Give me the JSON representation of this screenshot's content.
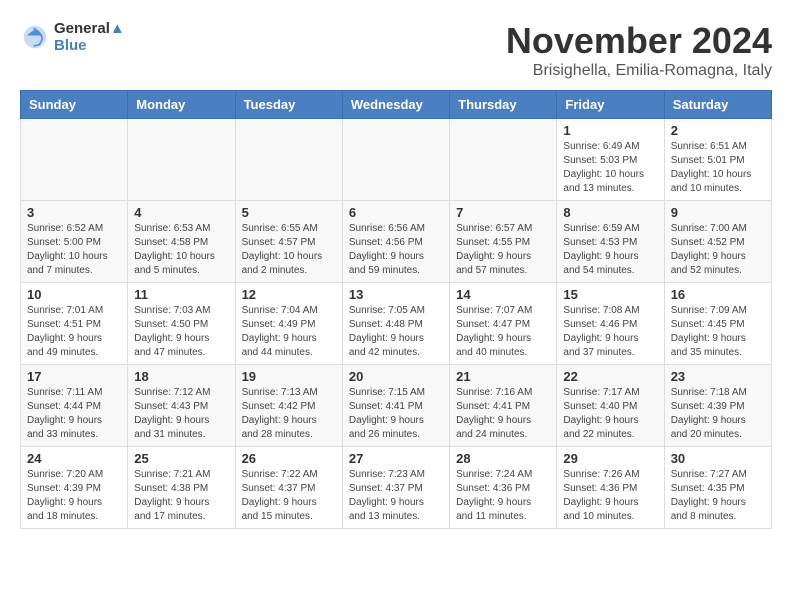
{
  "header": {
    "logo_line1": "General",
    "logo_line2": "Blue",
    "month": "November 2024",
    "location": "Brisighella, Emilia-Romagna, Italy"
  },
  "days_of_week": [
    "Sunday",
    "Monday",
    "Tuesday",
    "Wednesday",
    "Thursday",
    "Friday",
    "Saturday"
  ],
  "weeks": [
    [
      {
        "day": "",
        "info": ""
      },
      {
        "day": "",
        "info": ""
      },
      {
        "day": "",
        "info": ""
      },
      {
        "day": "",
        "info": ""
      },
      {
        "day": "",
        "info": ""
      },
      {
        "day": "1",
        "info": "Sunrise: 6:49 AM\nSunset: 5:03 PM\nDaylight: 10 hours\nand 13 minutes."
      },
      {
        "day": "2",
        "info": "Sunrise: 6:51 AM\nSunset: 5:01 PM\nDaylight: 10 hours\nand 10 minutes."
      }
    ],
    [
      {
        "day": "3",
        "info": "Sunrise: 6:52 AM\nSunset: 5:00 PM\nDaylight: 10 hours\nand 7 minutes."
      },
      {
        "day": "4",
        "info": "Sunrise: 6:53 AM\nSunset: 4:58 PM\nDaylight: 10 hours\nand 5 minutes."
      },
      {
        "day": "5",
        "info": "Sunrise: 6:55 AM\nSunset: 4:57 PM\nDaylight: 10 hours\nand 2 minutes."
      },
      {
        "day": "6",
        "info": "Sunrise: 6:56 AM\nSunset: 4:56 PM\nDaylight: 9 hours\nand 59 minutes."
      },
      {
        "day": "7",
        "info": "Sunrise: 6:57 AM\nSunset: 4:55 PM\nDaylight: 9 hours\nand 57 minutes."
      },
      {
        "day": "8",
        "info": "Sunrise: 6:59 AM\nSunset: 4:53 PM\nDaylight: 9 hours\nand 54 minutes."
      },
      {
        "day": "9",
        "info": "Sunrise: 7:00 AM\nSunset: 4:52 PM\nDaylight: 9 hours\nand 52 minutes."
      }
    ],
    [
      {
        "day": "10",
        "info": "Sunrise: 7:01 AM\nSunset: 4:51 PM\nDaylight: 9 hours\nand 49 minutes."
      },
      {
        "day": "11",
        "info": "Sunrise: 7:03 AM\nSunset: 4:50 PM\nDaylight: 9 hours\nand 47 minutes."
      },
      {
        "day": "12",
        "info": "Sunrise: 7:04 AM\nSunset: 4:49 PM\nDaylight: 9 hours\nand 44 minutes."
      },
      {
        "day": "13",
        "info": "Sunrise: 7:05 AM\nSunset: 4:48 PM\nDaylight: 9 hours\nand 42 minutes."
      },
      {
        "day": "14",
        "info": "Sunrise: 7:07 AM\nSunset: 4:47 PM\nDaylight: 9 hours\nand 40 minutes."
      },
      {
        "day": "15",
        "info": "Sunrise: 7:08 AM\nSunset: 4:46 PM\nDaylight: 9 hours\nand 37 minutes."
      },
      {
        "day": "16",
        "info": "Sunrise: 7:09 AM\nSunset: 4:45 PM\nDaylight: 9 hours\nand 35 minutes."
      }
    ],
    [
      {
        "day": "17",
        "info": "Sunrise: 7:11 AM\nSunset: 4:44 PM\nDaylight: 9 hours\nand 33 minutes."
      },
      {
        "day": "18",
        "info": "Sunrise: 7:12 AM\nSunset: 4:43 PM\nDaylight: 9 hours\nand 31 minutes."
      },
      {
        "day": "19",
        "info": "Sunrise: 7:13 AM\nSunset: 4:42 PM\nDaylight: 9 hours\nand 28 minutes."
      },
      {
        "day": "20",
        "info": "Sunrise: 7:15 AM\nSunset: 4:41 PM\nDaylight: 9 hours\nand 26 minutes."
      },
      {
        "day": "21",
        "info": "Sunrise: 7:16 AM\nSunset: 4:41 PM\nDaylight: 9 hours\nand 24 minutes."
      },
      {
        "day": "22",
        "info": "Sunrise: 7:17 AM\nSunset: 4:40 PM\nDaylight: 9 hours\nand 22 minutes."
      },
      {
        "day": "23",
        "info": "Sunrise: 7:18 AM\nSunset: 4:39 PM\nDaylight: 9 hours\nand 20 minutes."
      }
    ],
    [
      {
        "day": "24",
        "info": "Sunrise: 7:20 AM\nSunset: 4:39 PM\nDaylight: 9 hours\nand 18 minutes."
      },
      {
        "day": "25",
        "info": "Sunrise: 7:21 AM\nSunset: 4:38 PM\nDaylight: 9 hours\nand 17 minutes."
      },
      {
        "day": "26",
        "info": "Sunrise: 7:22 AM\nSunset: 4:37 PM\nDaylight: 9 hours\nand 15 minutes."
      },
      {
        "day": "27",
        "info": "Sunrise: 7:23 AM\nSunset: 4:37 PM\nDaylight: 9 hours\nand 13 minutes."
      },
      {
        "day": "28",
        "info": "Sunrise: 7:24 AM\nSunset: 4:36 PM\nDaylight: 9 hours\nand 11 minutes."
      },
      {
        "day": "29",
        "info": "Sunrise: 7:26 AM\nSunset: 4:36 PM\nDaylight: 9 hours\nand 10 minutes."
      },
      {
        "day": "30",
        "info": "Sunrise: 7:27 AM\nSunset: 4:35 PM\nDaylight: 9 hours\nand 8 minutes."
      }
    ]
  ]
}
